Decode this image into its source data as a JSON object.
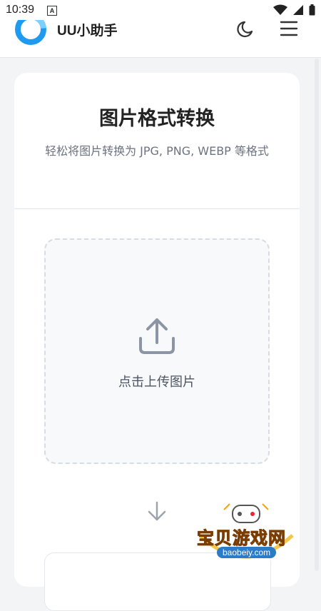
{
  "status_bar": {
    "time": "10:39",
    "notification_letter": "A"
  },
  "app": {
    "name": "UU小助手"
  },
  "card": {
    "title": "图片格式转换",
    "subtitle": "轻松将图片转换为 JPG, PNG, WEBP 等格式"
  },
  "upload": {
    "label": "点击上传图片"
  },
  "watermark": {
    "text": "宝贝游戏网",
    "url": "baobeiy.com"
  },
  "colors": {
    "accent": "#1e9bf0",
    "page_bg": "#f3f4f6",
    "card_bg": "#ffffff",
    "watermark": "#f4a30b"
  }
}
